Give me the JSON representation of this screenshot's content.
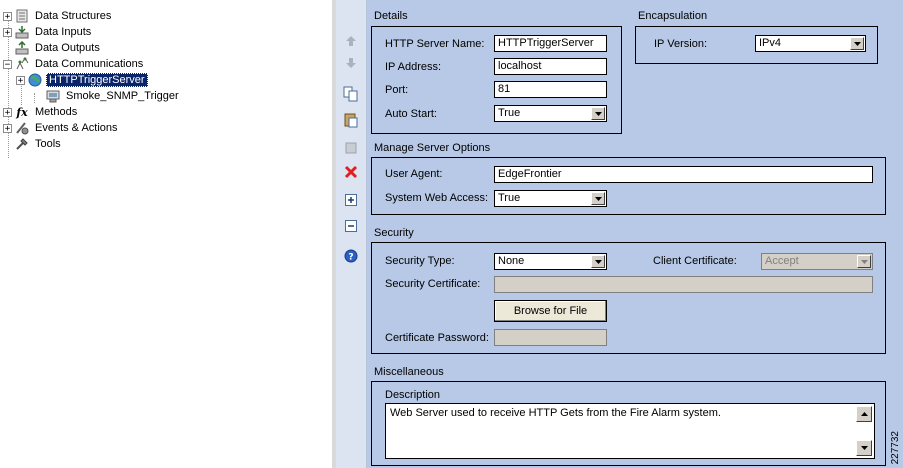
{
  "tree": {
    "items": [
      {
        "label": "Data Structures",
        "icon": "data-structures-icon"
      },
      {
        "label": "Data Inputs",
        "icon": "data-inputs-icon"
      },
      {
        "label": "Data Outputs",
        "icon": "data-outputs-icon"
      },
      {
        "label": "Data Communications",
        "icon": "data-communications-icon"
      },
      {
        "label": "HTTPTriggerServer",
        "icon": "globe-icon",
        "selected": true
      },
      {
        "label": "Smoke_SNMP_Trigger",
        "icon": "trigger-icon"
      },
      {
        "label": "Methods",
        "icon": "methods-icon"
      },
      {
        "label": "Events & Actions",
        "icon": "events-icon"
      },
      {
        "label": "Tools",
        "icon": "tools-icon"
      }
    ]
  },
  "toolbar": {
    "buttons": [
      "move-up-icon",
      "move-down-icon",
      "copy-icon",
      "paste-icon",
      "disabled-icon",
      "delete-icon",
      "expand-icon",
      "collapse-icon",
      "help-icon"
    ]
  },
  "details": {
    "title": "Details",
    "http_server_name_label": "HTTP Server Name:",
    "http_server_name": "HTTPTriggerServer",
    "ip_address_label": "IP Address:",
    "ip_address": "localhost",
    "port_label": "Port:",
    "port": "81",
    "auto_start_label": "Auto Start:",
    "auto_start": "True"
  },
  "encapsulation": {
    "title": "Encapsulation",
    "ip_version_label": "IP Version:",
    "ip_version": "IPv4"
  },
  "manage": {
    "title": "Manage Server Options",
    "user_agent_label": "User Agent:",
    "user_agent": "EdgeFrontier",
    "web_access_label": "System Web Access:",
    "web_access": "True"
  },
  "security": {
    "title": "Security",
    "type_label": "Security Type:",
    "type": "None",
    "client_cert_label": "Client Certificate:",
    "client_cert": "Accept",
    "cert_label": "Security Certificate:",
    "cert": "",
    "browse_label": "Browse for File",
    "password_label": "Certificate Password:",
    "password": ""
  },
  "misc": {
    "title": "Miscellaneous",
    "description_label": "Description",
    "description": "Web Server used to receive HTTP Gets from the Fire Alarm system."
  },
  "figure_number": "227732"
}
